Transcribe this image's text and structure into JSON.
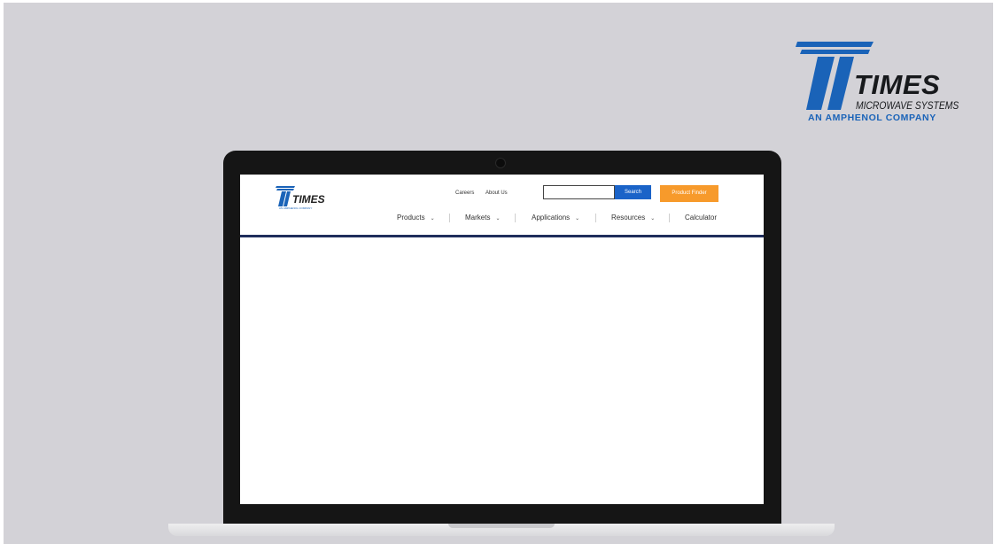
{
  "brand": {
    "name": "TIMES",
    "subtitle": "MICROWAVE SYSTEMS",
    "tagline": "AN AMPHENOL COMPANY",
    "logo_icon": "times-t-logo-icon",
    "accent_color": "#1a63b8"
  },
  "website": {
    "logo": {
      "name": "TIMES",
      "subtitle": "AN AMPHENOL COMPANY"
    },
    "utility_links": {
      "careers": "Careers",
      "about": "About Us"
    },
    "search": {
      "value": "",
      "button_label": "Search"
    },
    "product_finder_label": "Product Finder",
    "nav": {
      "products": "Products",
      "markets": "Markets",
      "applications": "Applications",
      "resources": "Resources",
      "calculator": "Calculator"
    },
    "colors": {
      "search_button": "#1a63c8",
      "product_finder_button": "#f79a2b",
      "header_rule": "#1f2d5c"
    }
  }
}
